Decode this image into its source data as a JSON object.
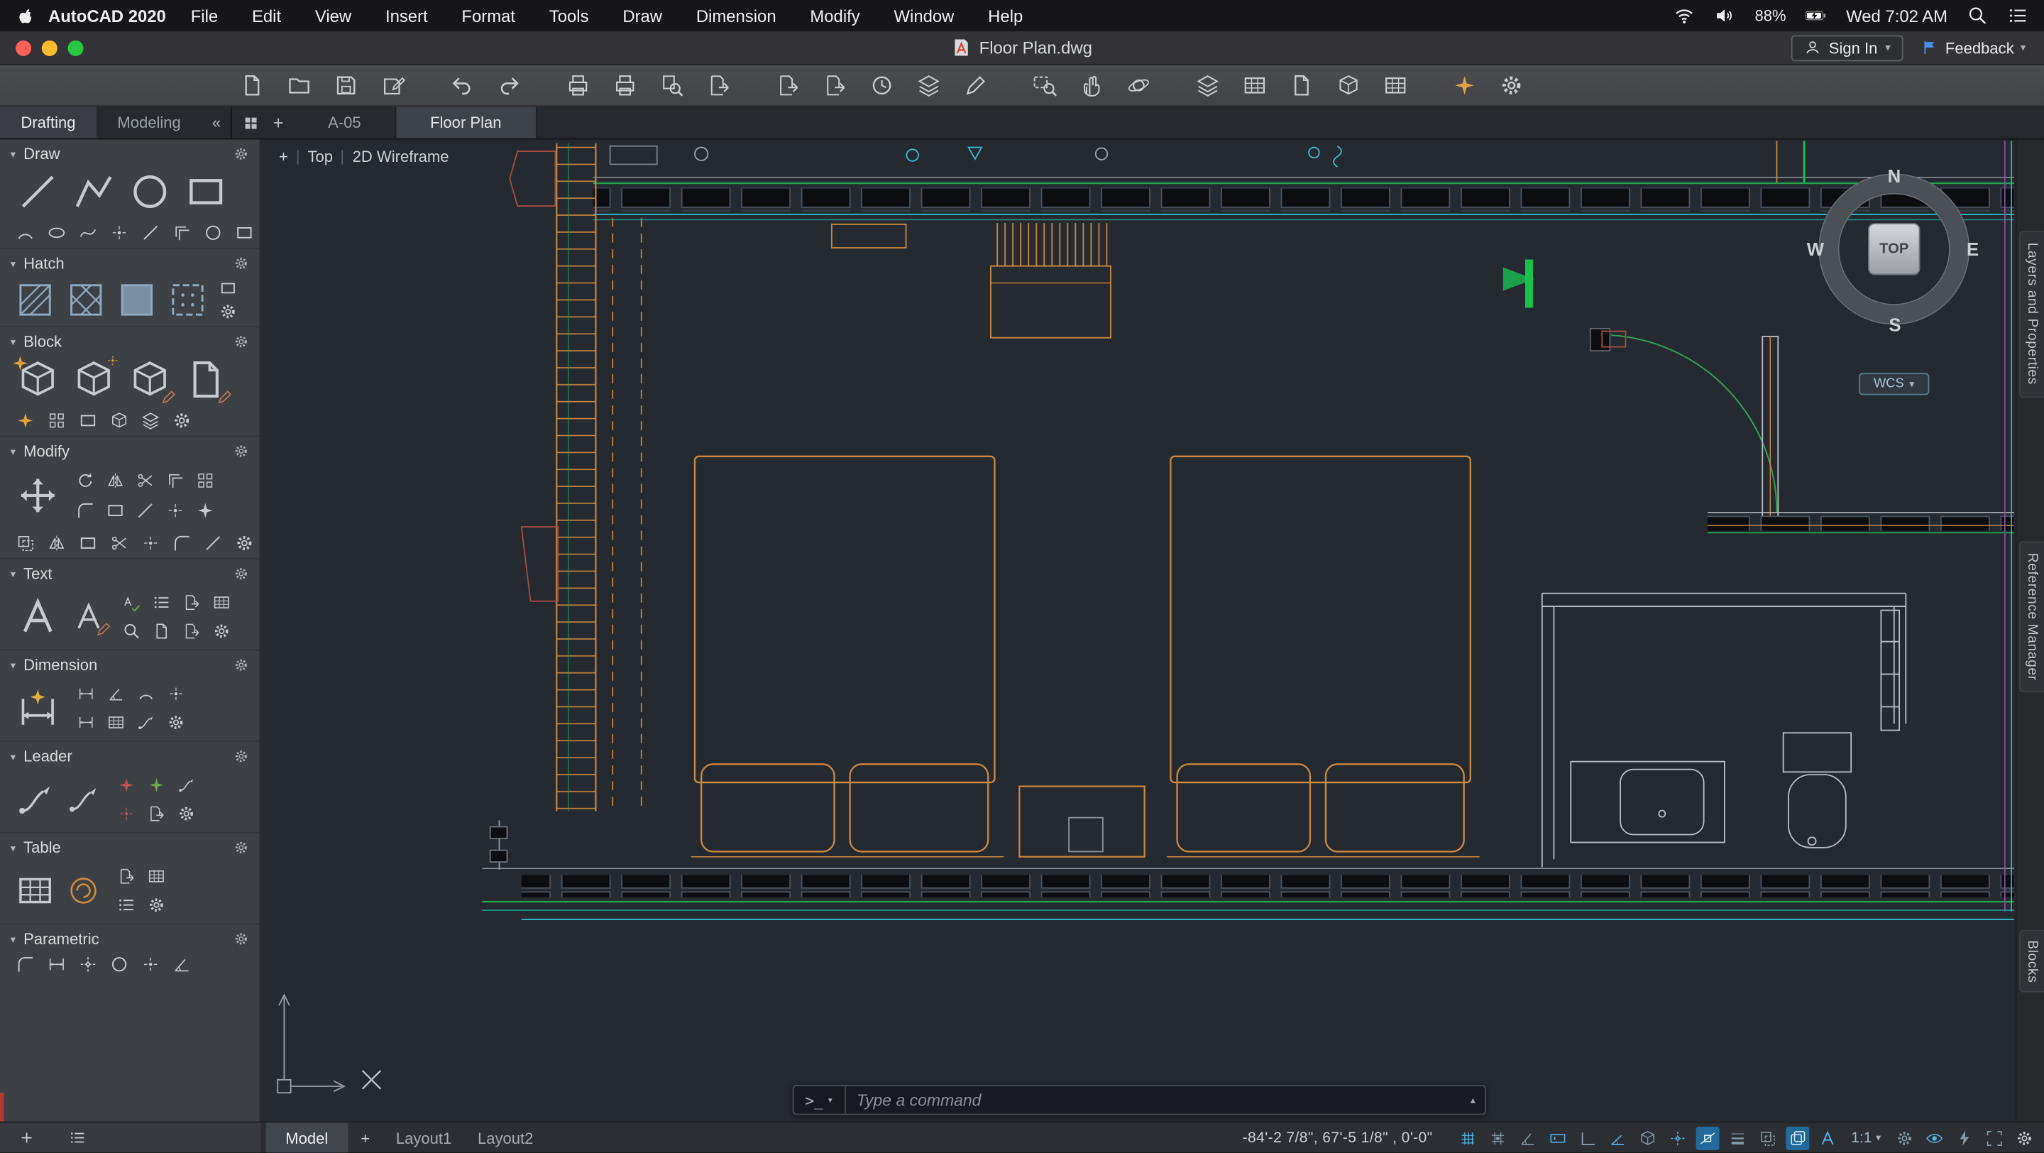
{
  "menubar": {
    "app_name": "AutoCAD 2020",
    "items": [
      "File",
      "Edit",
      "View",
      "Insert",
      "Format",
      "Tools",
      "Draw",
      "Dimension",
      "Modify",
      "Window",
      "Help"
    ],
    "status": {
      "battery_percent": "88%",
      "clock": "Wed 7:02 AM"
    },
    "icons": [
      "apple-logo",
      "wifi",
      "volume",
      "battery-charging",
      "spotlight-search",
      "menu-extras"
    ]
  },
  "titlebar": {
    "title": "Floor Plan.dwg",
    "sign_in": "Sign In",
    "feedback": "Feedback",
    "traffic_lights": [
      "close",
      "minimize",
      "zoom"
    ]
  },
  "toolbar": {
    "icons": [
      "qnew",
      "open",
      "save",
      "save-as",
      "undo",
      "redo",
      "plot",
      "batch-plot",
      "plot-preview",
      "publish",
      "import",
      "export",
      "etransmit",
      "sheet-set-manager",
      "markup",
      "zoom-window",
      "pan",
      "orbit",
      "layer-properties",
      "layer-states",
      "external-references",
      "block-editor",
      "tool-palettes",
      "whats-new",
      "options"
    ]
  },
  "workspace_tabs": {
    "tabs": [
      {
        "label": "Drafting",
        "active": true
      },
      {
        "label": "Modeling",
        "active": false
      }
    ],
    "collapse": "«"
  },
  "file_tabs": {
    "new_tab": "+",
    "tabs": [
      {
        "label": "A-05",
        "active": false
      },
      {
        "label": "Floor Plan",
        "active": true
      }
    ]
  },
  "viewport": {
    "controls": [
      "+",
      "Top",
      "2D Wireframe"
    ]
  },
  "viewcube": {
    "north": "N",
    "east": "E",
    "south": "S",
    "west": "W",
    "face": "TOP",
    "wcs": "WCS"
  },
  "side_panels": [
    "Layers and Properties",
    "Reference Manager",
    "Blocks"
  ],
  "sidebar": {
    "sections": [
      {
        "label": "Draw"
      },
      {
        "label": "Hatch"
      },
      {
        "label": "Block"
      },
      {
        "label": "Modify"
      },
      {
        "label": "Text"
      },
      {
        "label": "Dimension"
      },
      {
        "label": "Leader"
      },
      {
        "label": "Table"
      },
      {
        "label": "Parametric"
      }
    ]
  },
  "command_line": {
    "prompt": ">_",
    "placeholder": "Type a command"
  },
  "statusbar": {
    "model_tab": "Model",
    "new_layout": "+",
    "layouts": [
      "Layout1",
      "Layout2"
    ],
    "coordinates": "-84'-2 7/8\",  67'-5 1/8\" , 0'-0\"",
    "annotation_scale": "1:1",
    "icons": [
      "grid-display",
      "snap-mode",
      "infer-constraints",
      "dynamic-input",
      "ortho-mode",
      "polar-tracking",
      "isometric-drafting",
      "object-snap-tracking",
      "object-snap",
      "lineweight",
      "transparency",
      "selection-cycling",
      "annotation-visibility",
      "workspace-switching",
      "annotation-monitor",
      "quick-properties",
      "clean-screen",
      "customization"
    ]
  },
  "colors": {
    "canvas_bg": "#252a31",
    "wall_orange": "#c9873f",
    "line_green": "#23a14f",
    "line_cyan": "#35b9c9",
    "line_magenta": "#8655a8",
    "active_blue": "#53b5e8"
  }
}
